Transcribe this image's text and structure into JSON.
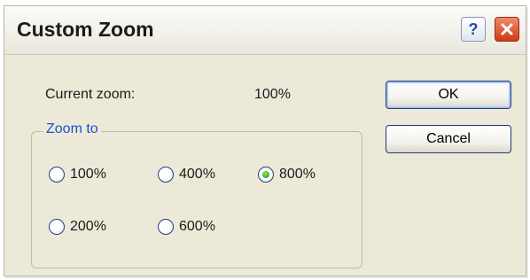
{
  "window": {
    "title": "Custom Zoom",
    "help_glyph": "?",
    "close_glyph": "close"
  },
  "current_zoom": {
    "label": "Current zoom:",
    "value": "100%"
  },
  "zoom_to": {
    "title": "Zoom to",
    "selected": "800%",
    "options": [
      "100%",
      "400%",
      "800%",
      "200%",
      "600%"
    ]
  },
  "buttons": {
    "ok": "OK",
    "cancel": "Cancel"
  },
  "colors": {
    "accent_group_title": "#1d4fd1",
    "radio_selected": "#1f9b12",
    "close_button": "#cf3b16"
  },
  "icons": {
    "help": "help-icon",
    "close": "close-icon"
  }
}
